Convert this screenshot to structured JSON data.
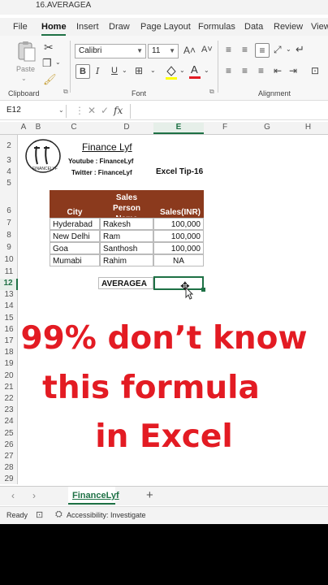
{
  "window": {
    "title": "16.AVERAGEA"
  },
  "menu": {
    "items": [
      "File",
      "Home",
      "Insert",
      "Draw",
      "Page Layout",
      "Formulas",
      "Data",
      "Review",
      "View"
    ],
    "active": "Home"
  },
  "ribbon": {
    "paste_label": "Paste",
    "font_name": "Calibri",
    "font_size": "11",
    "bold": "B",
    "italic": "I",
    "underline": "U",
    "groups": {
      "clipboard": "Clipboard",
      "font": "Font",
      "alignment": "Alignment"
    }
  },
  "formula_bar": {
    "name_box": "E12",
    "fx": "fx",
    "formula": ""
  },
  "columns": [
    "A",
    "B",
    "C",
    "D",
    "E",
    "F",
    "G",
    "H"
  ],
  "selected_column": "E",
  "rows": [
    "2",
    "3",
    "4",
    "5",
    "6",
    "7",
    "8",
    "9",
    "10",
    "11",
    "12",
    "13",
    "14",
    "15",
    "16",
    "17",
    "18",
    "19",
    "20",
    "21",
    "22",
    "23",
    "24",
    "25",
    "26",
    "27",
    "28",
    "29"
  ],
  "selected_row": "12",
  "sheet": {
    "brand_title": "Finance Lyf",
    "youtube": "Youtube : FinanceLyf",
    "twitter": "Twitter : FinanceLyf",
    "tip": "Excel Tip-16",
    "logo_text": "FINANCELYF",
    "table": {
      "headers": [
        "City",
        "Sales Person Name",
        "Sales(INR)"
      ],
      "rows": [
        [
          "Hyderabad",
          "Rakesh",
          "100,000"
        ],
        [
          "New Delhi",
          "Ram",
          "100,000"
        ],
        [
          "Goa",
          "Santhosh",
          "100,000"
        ],
        [
          "Mumabi",
          "Rahim",
          "NA"
        ]
      ]
    },
    "func_label": "AVERAGEA"
  },
  "overlay": {
    "line1": "99% don’t know",
    "line2": "this formula",
    "line3": "in Excel"
  },
  "tabs": {
    "sheet_name": "FinanceLyf",
    "add": "+"
  },
  "status": {
    "ready": "Ready",
    "accessibility": "Accessibility: Investigate"
  },
  "colors": {
    "accent": "#1e7145",
    "header_fill": "#8b3a1d",
    "overlay_text": "#e31b23"
  }
}
